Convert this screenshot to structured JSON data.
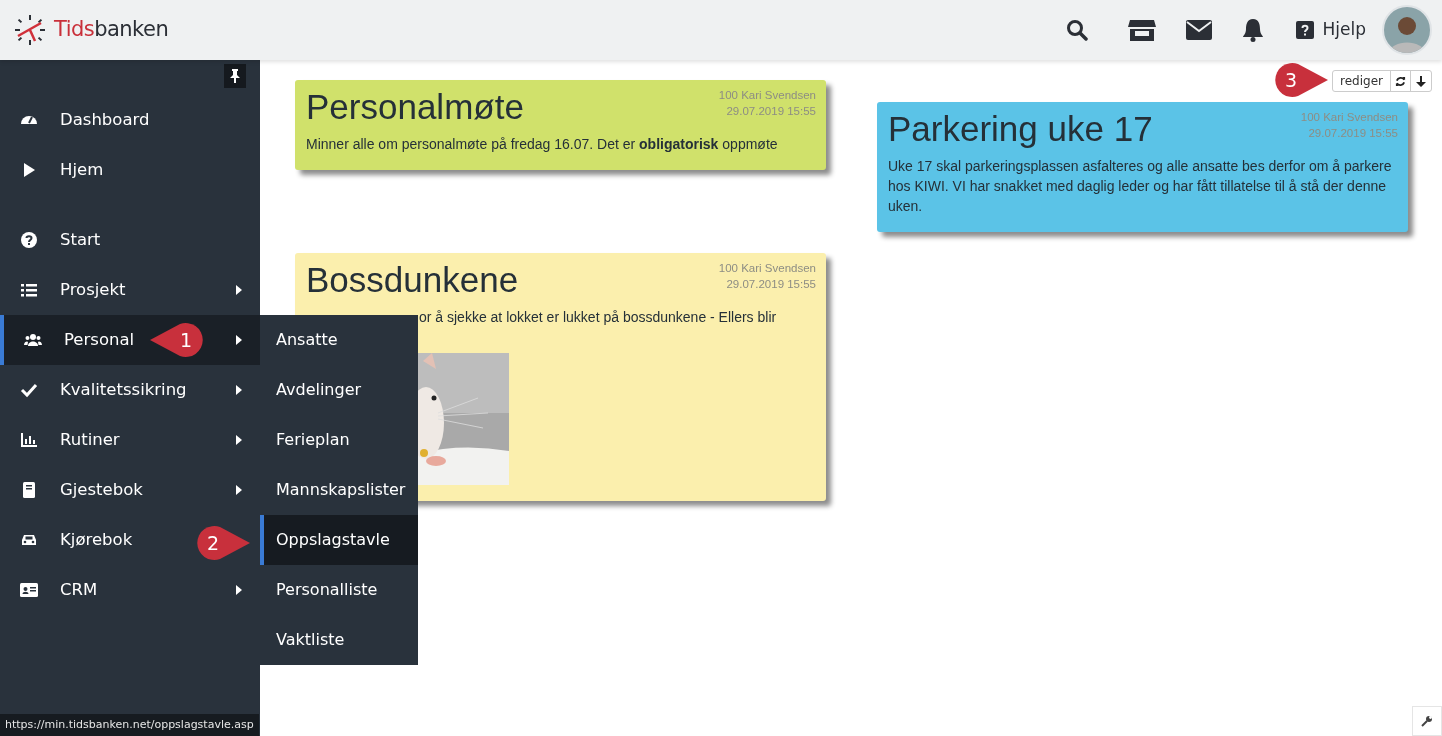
{
  "header": {
    "brand_first": "Tids",
    "brand_rest": "banken",
    "help_label": "Hjelp"
  },
  "sidebar": {
    "groups": [
      [
        {
          "label": "Dashboard",
          "has_submenu": false,
          "selected": false
        },
        {
          "label": "Hjem",
          "has_submenu": false,
          "selected": false
        }
      ],
      [
        {
          "label": "Start",
          "has_submenu": false,
          "selected": false
        },
        {
          "label": "Prosjekt",
          "has_submenu": true,
          "selected": false
        },
        {
          "label": "Personal",
          "has_submenu": true,
          "selected": true
        },
        {
          "label": "Kvalitetssikring",
          "has_submenu": true,
          "selected": false
        },
        {
          "label": "Rutiner",
          "has_submenu": true,
          "selected": false
        },
        {
          "label": "Gjestebok",
          "has_submenu": true,
          "selected": false
        },
        {
          "label": "Kjørebok",
          "has_submenu": false,
          "selected": false
        },
        {
          "label": "CRM",
          "has_submenu": true,
          "selected": false
        }
      ]
    ]
  },
  "submenu": {
    "items": [
      {
        "label": "Ansatte",
        "selected": false
      },
      {
        "label": "Avdelinger",
        "selected": false
      },
      {
        "label": "Ferieplan",
        "selected": false
      },
      {
        "label": "Mannskapslister",
        "selected": false
      },
      {
        "label": "Oppslagstavle",
        "selected": true
      },
      {
        "label": "Personalliste",
        "selected": false
      },
      {
        "label": "Vaktliste",
        "selected": false
      }
    ]
  },
  "toolbar": {
    "edit_label": "rediger"
  },
  "note_columns": [
    {
      "notes": [
        {
          "title": "Personalmøte",
          "author": "100 Kari Svendsen",
          "date": "29.07.2019 15:55",
          "body": "Minner alle om personalmøte på fredag 16.07. Det er **obligatorisk** oppmøte",
          "color": "#d0e16b"
        },
        {
          "title": "Bossdunkene",
          "author": "100 Kari Svendsen",
          "date": "29.07.2019 15:55",
          "body": "or å sjekke at lokket er lukket på bossdunkene - Ellers blir",
          "color": "#fbefad"
        }
      ]
    },
    {
      "notes": [
        {
          "title": "Parkering uke 17",
          "author": "100 Kari Svendsen",
          "date": "29.07.2019 15:55",
          "body": "Uke 17 skal parkeringsplassen asfalteres og alle ansatte bes derfor om å parkere hos KIWI. VI har snakket med daglig leder og har fått tillatelse til å stå der denne uken.",
          "color": "#5bc3e7"
        }
      ]
    }
  ],
  "callouts": [
    {
      "number": "1"
    },
    {
      "number": "2"
    },
    {
      "number": "3"
    }
  ],
  "status_url": "https://min.tidsbanken.net/oppslagstavle.asp"
}
